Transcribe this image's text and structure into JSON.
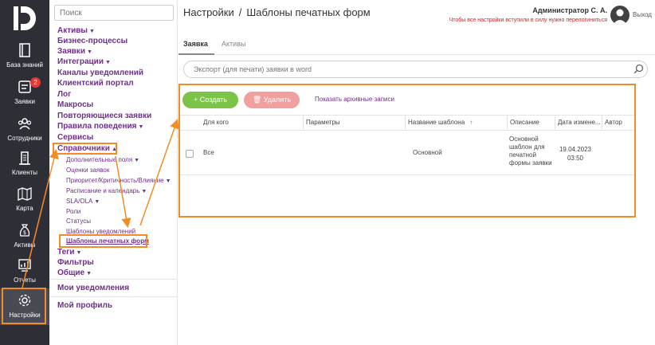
{
  "rail": {
    "items": [
      {
        "label": "База знаний",
        "icon": "book-icon"
      },
      {
        "label": "Заявки",
        "icon": "ticket-icon",
        "badge": "2"
      },
      {
        "label": "Сотрудники",
        "icon": "users-icon"
      },
      {
        "label": "Клиенты",
        "icon": "building-icon"
      },
      {
        "label": "Карта",
        "icon": "map-icon"
      },
      {
        "label": "Активы",
        "icon": "money-bag-icon"
      },
      {
        "label": "Отчеты",
        "icon": "report-icon"
      },
      {
        "label": "Настройки",
        "icon": "gear-icon"
      }
    ]
  },
  "menu": {
    "search_placeholder": "Поиск",
    "top": [
      "Активы",
      "Бизнес-процессы",
      "Заявки",
      "Интеграции",
      "Каналы уведомлений",
      "Клиентский портал",
      "Лог",
      "Макросы",
      "Повторяющиеся заявки",
      "Правила поведения",
      "Сервисы",
      "Справочники"
    ],
    "sub": [
      "Дополнительные поля",
      "Оценки заявок",
      "Приоритет/Критичность/Влияние",
      "Расписание и календарь",
      "SLA/OLA",
      "Роли",
      "Статусы",
      "Шаблоны уведомлений",
      "Шаблоны печатных форм"
    ],
    "bottom": [
      "Теги",
      "Фильтры",
      "Общие"
    ],
    "notifications": "Мои уведомления",
    "profile": "Мой профиль"
  },
  "header": {
    "section": "Настройки",
    "separator": "/",
    "page": "Шаблоны печатных форм",
    "user": "Администратор С. А.",
    "warning": "Чтобы все настройки вступили в силу нужно перелогиниться",
    "logout": "Выход"
  },
  "tabs": [
    "Заявка",
    "Активы"
  ],
  "search_placeholder": "Экспорт (для печати) заявки в word",
  "toolbar": {
    "create": "+ Создать",
    "delete": "Удалить",
    "archive": "Показать архивные записи"
  },
  "table": {
    "headers": [
      "Для кого",
      "Параметры",
      "Название шаблона",
      "Описание",
      "Дата измене...",
      "Автор"
    ],
    "sort_arrow": "↑",
    "rows": [
      {
        "for": "Все",
        "params": "",
        "name": "Основной",
        "description": "Основной шаблон для печатной формы заявки",
        "date": "19.04.2023 03:50",
        "author": ""
      }
    ]
  },
  "colors": {
    "accent": "#6e2f8c",
    "highlight": "#f28c28",
    "create": "#7cc34a",
    "delete": "#f1a0a0",
    "rail": "#2e2e36"
  }
}
